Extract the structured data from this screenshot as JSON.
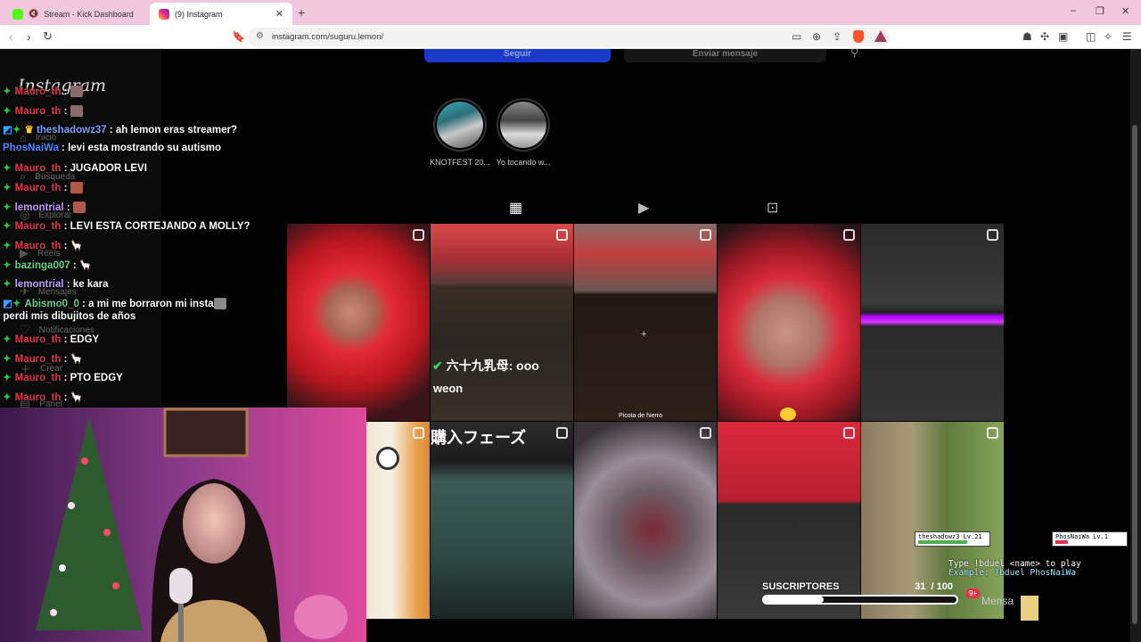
{
  "browser": {
    "tabs": [
      {
        "title": "Stream - Kick Dashboard",
        "active": false
      },
      {
        "title": "(9) Instagram",
        "active": true
      }
    ],
    "new_tab": "+",
    "url": "instagram.com/suguru.lemon/",
    "window_controls": {
      "minimize": "–",
      "maximize": "❐",
      "close": "✕"
    }
  },
  "instagram": {
    "logo": "Instagram",
    "nav": [
      "Inicio",
      "Búsqueda",
      "Explorar",
      "Reels",
      "Mensajes",
      "Notificaciones",
      "Crear",
      "Panel"
    ],
    "follow_button": "Seguir",
    "message_button": "Enviar mensaje",
    "highlights": [
      {
        "label": "KNOTFEST 20..."
      },
      {
        "label": "Yo tocando w..."
      }
    ],
    "profile_tabs": [
      "posts-grid",
      "reels",
      "tagged"
    ],
    "post_captions": {
      "cjk_overlay": "六十九乳母: ooo",
      "weon": "weon",
      "picota": "Picota de hierro",
      "japanese": "購入フェーズ"
    }
  },
  "chat": [
    {
      "user": "Mauro_th",
      "color": "#e0364b",
      "text": ""
    },
    {
      "user": "Mauro_th",
      "color": "#e0364b",
      "text": ""
    },
    {
      "user": "theshadowz37",
      "color": "#7aa2ff",
      "text": "ah lemon eras streamer?"
    },
    {
      "user": "PhosNaiWa",
      "color": "#4f86ff",
      "text": "levi esta mostrando su autismo"
    },
    {
      "user": "Mauro_th",
      "color": "#e0364b",
      "text": "JUGADOR LEVI"
    },
    {
      "user": "Mauro_th",
      "color": "#e0364b",
      "text": ""
    },
    {
      "user": "lemontrial",
      "color": "#c19bff",
      "text": ""
    },
    {
      "user": "Mauro_th",
      "color": "#e0364b",
      "text": "LEVI ESTA CORTEJANDO A MOLLY?"
    },
    {
      "user": "Mauro_th",
      "color": "#e0364b",
      "text": ""
    },
    {
      "user": "bazinga007",
      "color": "#6ad18c",
      "text": ""
    },
    {
      "user": "lemontrial",
      "color": "#c19bff",
      "text": "ke kara"
    },
    {
      "user": "Abismo0_0",
      "color": "#6ad18c",
      "text": "a mi me borraron mi insta"
    },
    {
      "user": "",
      "color": "#ffffff",
      "text": ", perdi mis dibujitos de años"
    },
    {
      "user": "Mauro_th",
      "color": "#e0364b",
      "text": "EDGY"
    },
    {
      "user": "Mauro_th",
      "color": "#e0364b",
      "text": ""
    },
    {
      "user": "Mauro_th",
      "color": "#e0364b",
      "text": "PTO EDGY"
    },
    {
      "user": "Mauro_th",
      "color": "#e0364b",
      "text": ""
    }
  ],
  "overlay": {
    "subs_label": "SUSCRIPTORES",
    "subs_count": "31",
    "subs_goal": "/ 100",
    "subs_progress": 0.31,
    "duel_line1": "Type !bduel <name> to play",
    "duel_line2": "Example: !bduel PhosNaiWa",
    "player1": "theshadowz3",
    "player1_level": "Lv.21",
    "player2": "PhosNaiWa",
    "player2_level": "Lv.1",
    "mensa": "Mensa",
    "notif_count": "9+"
  }
}
